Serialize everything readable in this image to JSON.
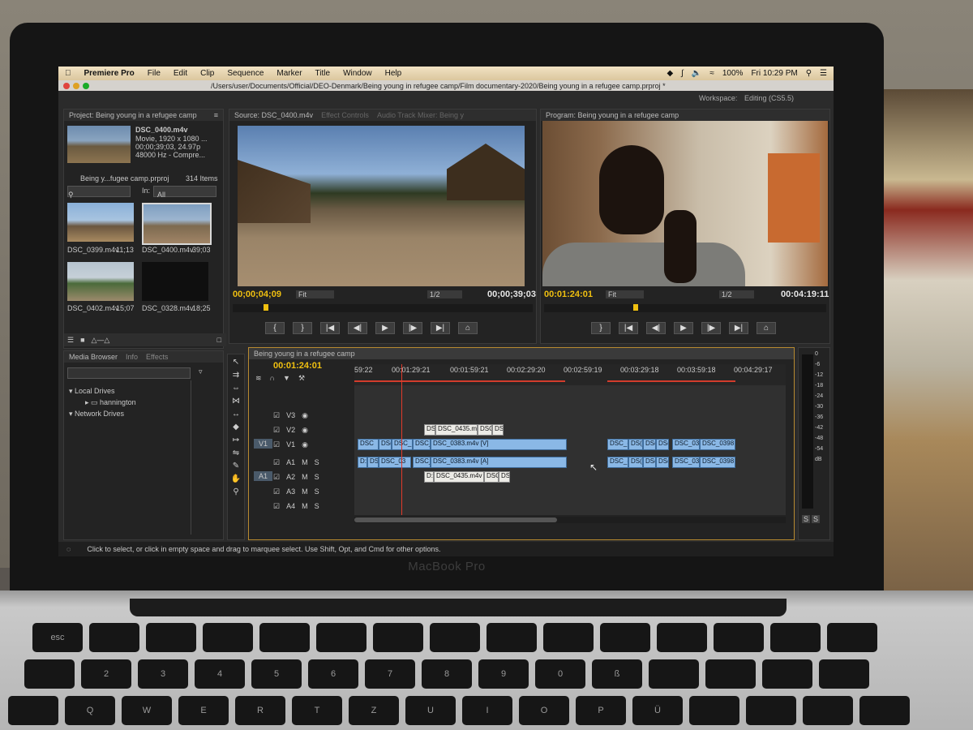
{
  "menubar": {
    "app_name": "Premiere Pro",
    "items": [
      "File",
      "Edit",
      "Clip",
      "Sequence",
      "Marker",
      "Title",
      "Window",
      "Help"
    ],
    "status": {
      "battery": "100%",
      "clock": "Fri 10:29 PM"
    }
  },
  "window": {
    "path": "/Users/user/Documents/Official/DEO-Denmark/Being young in refugee camp/Film documentary-2020/Being young in a refugee camp.prproj *"
  },
  "workspace": {
    "label": "Workspace:",
    "value": "Editing (CS5.5)"
  },
  "project": {
    "title": "Project: Being young in a refugee camp",
    "clip_name": "DSC_0400.m4v",
    "clip_info_1": "Movie, 1920 x 1080 ...",
    "clip_info_2": "00;00;39;03, 24.97p",
    "clip_info_3": "48000 Hz - Compre...",
    "bin_name": "Being y...fugee camp.prproj",
    "bin_count": "314 Items",
    "in_label": "In:",
    "in_value": "All",
    "thumbs": [
      {
        "name": "DSC_0399.m4v",
        "dur": "11;13"
      },
      {
        "name": "DSC_0400.m4v",
        "dur": "39;03"
      },
      {
        "name": "DSC_0402.m4v",
        "dur": "15;07"
      },
      {
        "name": "DSC_0328.m4v",
        "dur": "18;25"
      }
    ]
  },
  "source": {
    "tab": "Source: DSC_0400.m4v",
    "tab2": "Effect Controls",
    "tab3": "Audio Track Mixer: Being y",
    "timecode_in": "00;00;04;09",
    "fit": "Fit",
    "ratio": "1/2",
    "timecode_out": "00;00;39;03"
  },
  "program": {
    "tab": "Program: Being young in a refugee camp",
    "timecode_in": "00:01:24:01",
    "fit": "Fit",
    "ratio": "1/2",
    "timecode_out": "00:04:19:11"
  },
  "media_browser": {
    "tabs": [
      "Media Browser",
      "Info",
      "Effects"
    ],
    "local_drives": "Local Drives",
    "drive": "hannington",
    "network_drives": "Network Drives"
  },
  "timeline": {
    "tab": "Being young in a refugee camp",
    "timecode": "00:01:24:01",
    "ruler": [
      "59:22",
      "00:01:29:21",
      "00:01:59:21",
      "00:02:29:20",
      "00:02:59:19",
      "00:03:29:18",
      "00:03:59:18",
      "00:04:29:17"
    ],
    "video_tracks": [
      "V3",
      "V2",
      "V1"
    ],
    "audio_tracks": [
      "A1",
      "A2",
      "A3",
      "A4"
    ],
    "src_v": "V1",
    "src_a": "A1",
    "clips": {
      "v2_a": "DS",
      "v2_b": "DSC_0435.m",
      "v2_c": "DSC",
      "v2_d": "DS(",
      "v1_a": "DSC",
      "v1_b": "DS(",
      "v1_c": "DSC_",
      "v1_d": "DSC_",
      "v1_e": "DSC_0383.m4v [V]",
      "v1_f": "DSC_(",
      "v1_g": "DS(",
      "v1_h": "DS(",
      "v1_i": "DS(",
      "v1_j": "DSC_03",
      "v1_k": "DSC_0398",
      "a1_a": "D:",
      "a1_b": "DSC",
      "a1_c": "DSC_03",
      "a1_d": "DSC_",
      "a1_e": "DSC_0383.m4v [A]",
      "a1_f": "DSC_(",
      "a1_g": "DS(",
      "a1_h": "DS(",
      "a1_i": "DS(",
      "a1_j": "DSC_03",
      "a1_k": "DSC_0398",
      "a2_a": "D:",
      "a2_b": "DSC_0435.m4v",
      "a2_c": "DSC",
      "a2_d": "DS("
    },
    "meter_ticks": [
      "0",
      "-6",
      "-12",
      "-18",
      "-24",
      "-30",
      "-36",
      "-42",
      "-48",
      "-54",
      "dB"
    ]
  },
  "status_bar": "Click to select, or click in empty space and drag to marquee select. Use Shift, Opt, and Cmd for other options.",
  "hardware": {
    "brand": "MacBook Pro"
  }
}
